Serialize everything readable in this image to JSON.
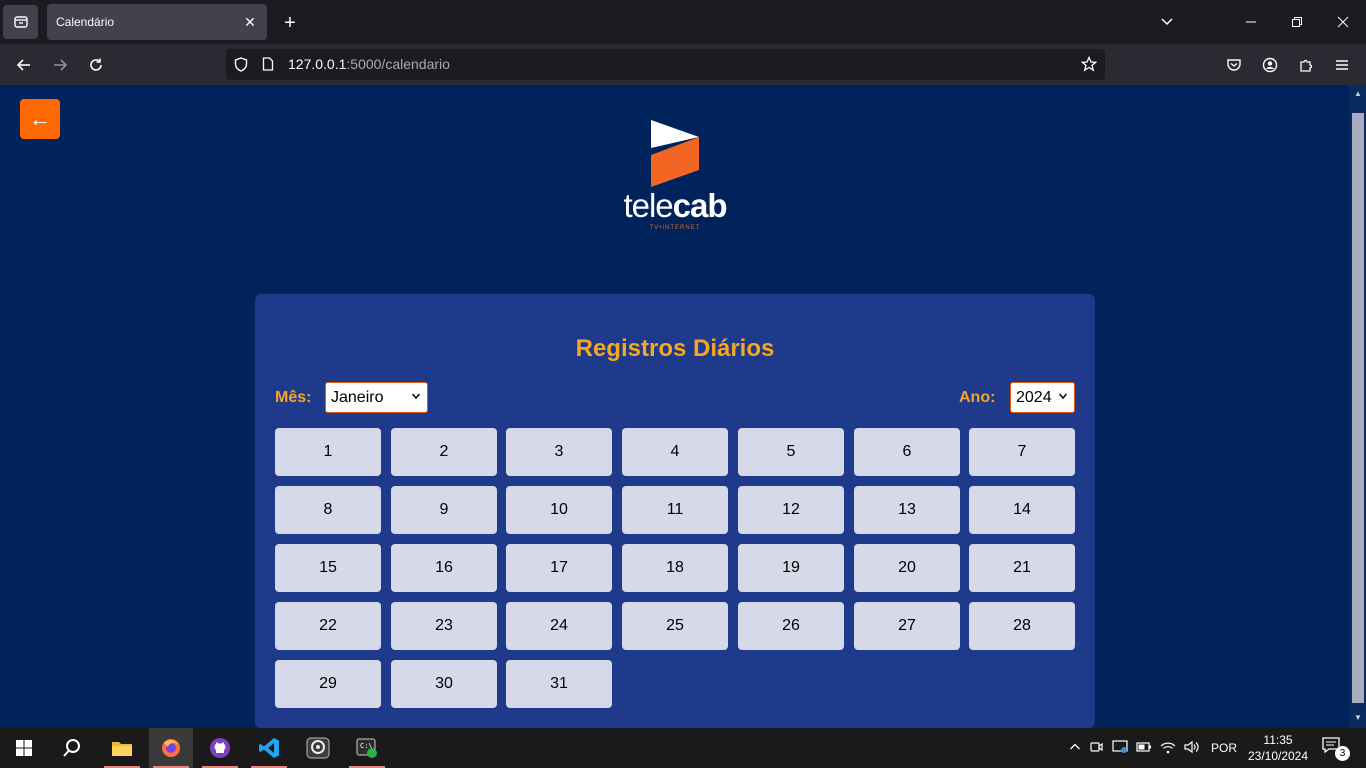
{
  "browser": {
    "tab_title": "Calendário",
    "url_host": "127.0.0.1",
    "url_path": ":5000/calendario"
  },
  "page": {
    "back_label": "←",
    "logo": {
      "text_light": "tele",
      "text_bold": "cab",
      "tagline": "TV•INTERNET"
    },
    "panel": {
      "title": "Registros Diários",
      "month_label": "Mês:",
      "month_value": "Janeiro",
      "year_label": "Ano:",
      "year_value": "2024",
      "days": [
        "1",
        "2",
        "3",
        "4",
        "5",
        "6",
        "7",
        "8",
        "9",
        "10",
        "11",
        "12",
        "13",
        "14",
        "15",
        "16",
        "17",
        "18",
        "19",
        "20",
        "21",
        "22",
        "23",
        "24",
        "25",
        "26",
        "27",
        "28",
        "29",
        "30",
        "31"
      ]
    }
  },
  "taskbar": {
    "language": "POR",
    "time": "11:35",
    "date": "23/10/2024",
    "notification_count": "3"
  },
  "colors": {
    "page_bg": "#00235b",
    "panel_bg": "#1f3a8a",
    "accent_orange": "#f5a623",
    "back_button": "#ff6a00",
    "day_button": "#d6dae8"
  }
}
